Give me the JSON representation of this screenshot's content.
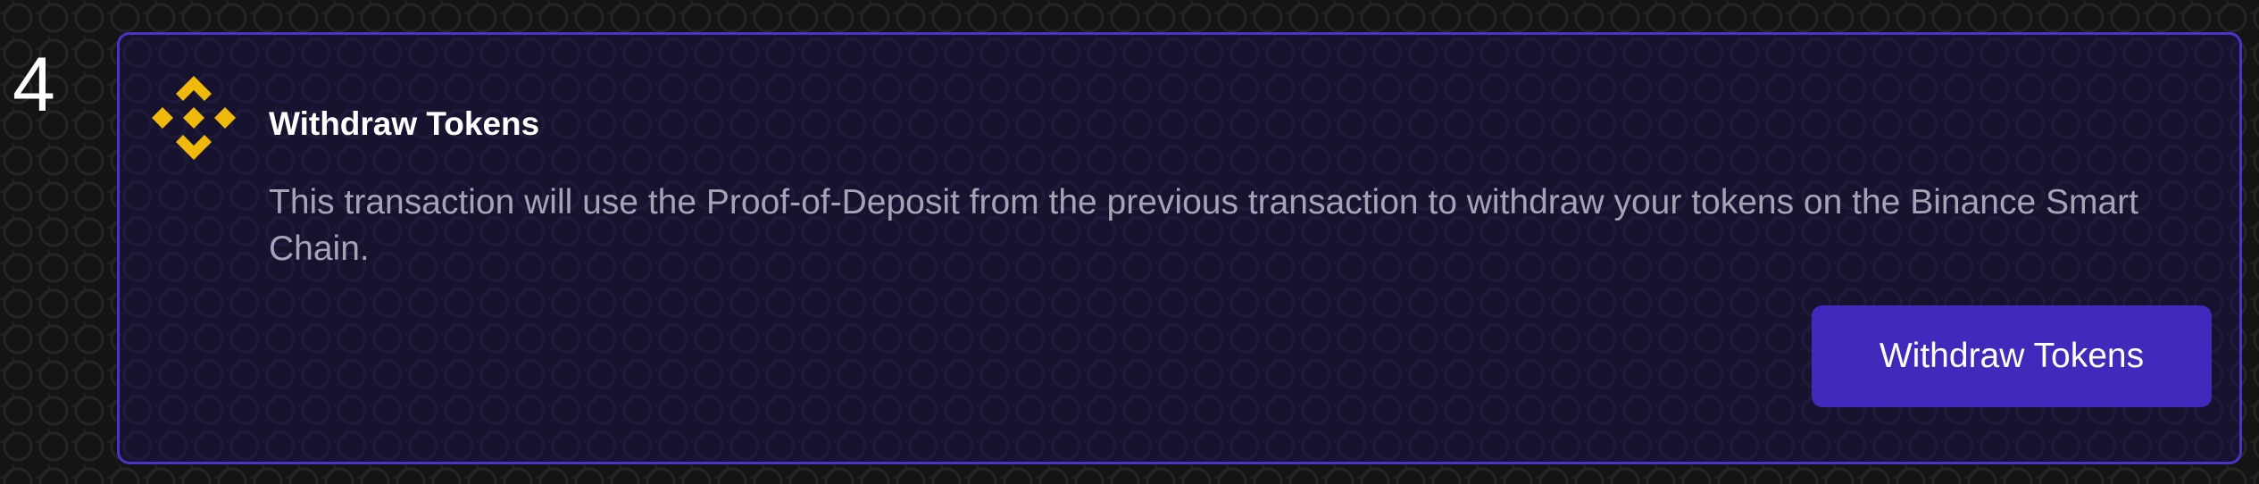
{
  "step": {
    "number": "4"
  },
  "card": {
    "title": "Withdraw Tokens",
    "description": "This transaction will use the Proof-of-Deposit from the previous transaction to withdraw your tokens on the Binance Smart Chain.",
    "logo_icon": "binance-logo-icon",
    "button_label": "Withdraw Tokens"
  },
  "colors": {
    "accent": "#3f2abc",
    "card_border": "#4a33c6",
    "card_background": "#17132f",
    "logo": "#f0b90b",
    "description_text": "#a7a3b6"
  }
}
